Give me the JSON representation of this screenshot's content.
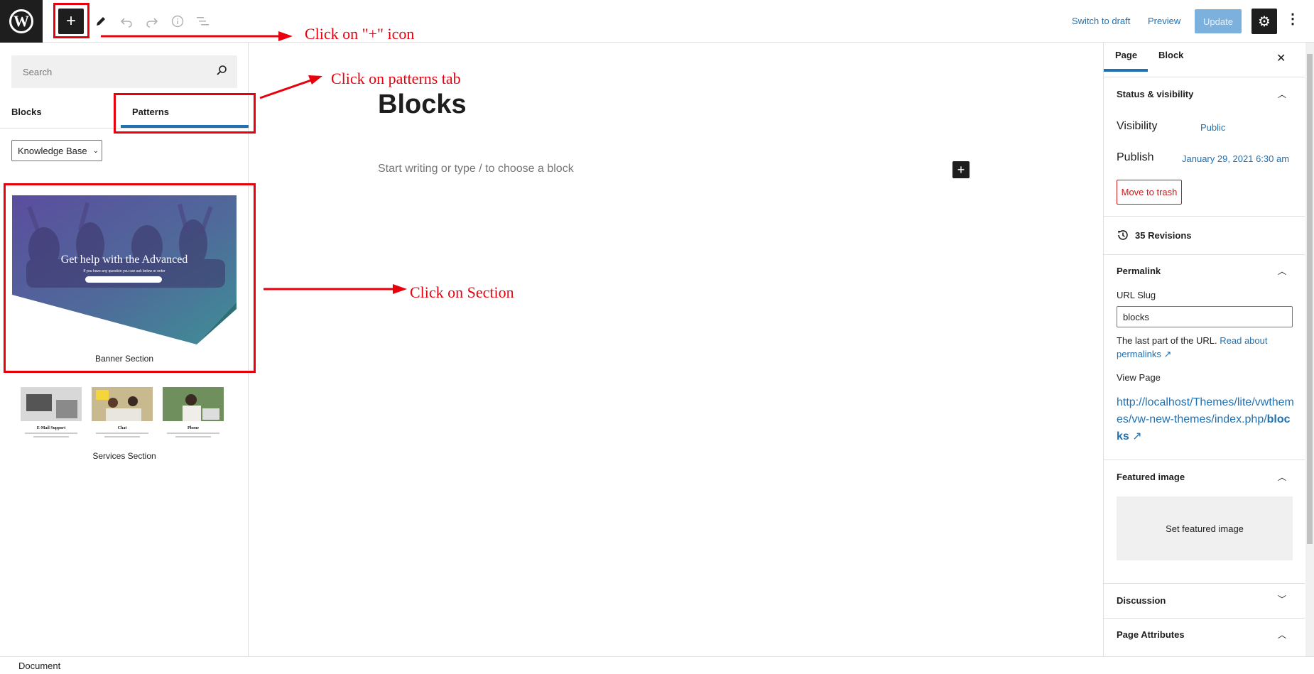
{
  "topbar": {
    "switch_to_draft": "Switch to draft",
    "preview": "Preview",
    "update": "Update"
  },
  "inserter": {
    "search_placeholder": "Search",
    "tabs": [
      "Blocks",
      "Patterns"
    ],
    "active_tab": "Patterns",
    "category": "Knowledge Base",
    "patterns": [
      {
        "label": "Banner Section",
        "heading": "Get help with the Advanced",
        "subtext": "If you have any question you can ask below or enter"
      },
      {
        "label": "Services Section",
        "cards": [
          "E-Mail Support",
          "Chat",
          "Phone"
        ]
      }
    ]
  },
  "canvas": {
    "title": "Blocks",
    "placeholder": "Start writing or type / to choose a block"
  },
  "annotations": {
    "plus_icon": "Click on \"+\" icon",
    "patterns_tab": "Click on patterns tab",
    "section": "Click on Section",
    "color": "#e8000d"
  },
  "sidebar": {
    "tabs": [
      "Page",
      "Block"
    ],
    "active_tab": "Page",
    "status_visibility": "Status & visibility",
    "visibility_label": "Visibility",
    "visibility_value": "Public",
    "publish_label": "Publish",
    "publish_value": "January 29, 2021 6:30 am",
    "move_to_trash": "Move to trash",
    "revisions": "35 Revisions",
    "permalink": "Permalink",
    "url_slug_label": "URL Slug",
    "url_slug_value": "blocks",
    "url_help": "The last part of the URL.",
    "url_help_link": "Read about permalinks",
    "view_page": "View Page",
    "view_page_url": "http://localhost/Themes/lite/vwthemes/vw-new-themes/index.php/",
    "view_page_url_slug": "blocks",
    "featured_image": "Featured image",
    "set_featured_image": "Set featured image",
    "discussion": "Discussion",
    "page_attributes": "Page Attributes"
  },
  "footer": {
    "breadcrumb": "Document"
  },
  "colors": {
    "accent": "#2271b1",
    "dark": "#1e1e1e",
    "danger": "#cc1818"
  }
}
